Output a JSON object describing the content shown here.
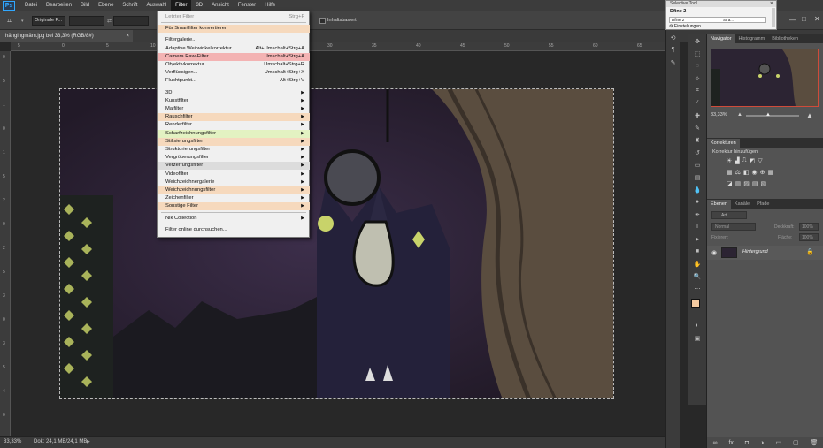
{
  "menubar": {
    "items": [
      "Datei",
      "Bearbeiten",
      "Bild",
      "Ebene",
      "Schrift",
      "Auswahl",
      "Filter",
      "3D",
      "Ansicht",
      "Fenster",
      "Hilfe"
    ],
    "active": "Filter",
    "logo": "Ps"
  },
  "options": {
    "preset": "Originale P...",
    "checkbox_label": "Inhaltsbasiert"
  },
  "document": {
    "tab_title": "hängingmäm.jpg bei 33,3% (RGB/8#)",
    "zoom": "33,33%",
    "doc_info": "Dok: 24,1 MB/24,1 MB"
  },
  "filter_menu": {
    "rows": [
      {
        "label": "Letzter Filter",
        "shortcut": "Strg+F",
        "highlight": "none",
        "disabled": true,
        "arrow": false
      },
      {
        "label": "Für Smartfilter konvertieren",
        "shortcut": "",
        "highlight": "orange",
        "disabled": false,
        "arrow": false
      },
      {
        "label": "Filtergalerie...",
        "shortcut": "",
        "highlight": "none",
        "disabled": false,
        "arrow": false
      },
      {
        "label": "Adaptive Weitwinkelkorrektur...",
        "shortcut": "Alt+Umschalt+Strg+A",
        "highlight": "none",
        "disabled": false,
        "arrow": false
      },
      {
        "label": "Camera Raw-Filter...",
        "shortcut": "Umschalt+Strg+A",
        "highlight": "red",
        "disabled": false,
        "arrow": false
      },
      {
        "label": "Objektivkorrektur...",
        "shortcut": "Umschalt+Strg+R",
        "highlight": "none",
        "disabled": false,
        "arrow": false
      },
      {
        "label": "Verflüssigen...",
        "shortcut": "Umschalt+Strg+X",
        "highlight": "none",
        "disabled": false,
        "arrow": false
      },
      {
        "label": "Fluchtpunkt...",
        "shortcut": "Alt+Strg+V",
        "highlight": "none",
        "disabled": false,
        "arrow": false
      },
      {
        "label": "3D",
        "shortcut": "",
        "highlight": "none",
        "disabled": false,
        "arrow": true
      },
      {
        "label": "Kunstfilter",
        "shortcut": "",
        "highlight": "none",
        "disabled": false,
        "arrow": true
      },
      {
        "label": "Malfilter",
        "shortcut": "",
        "highlight": "none",
        "disabled": false,
        "arrow": true
      },
      {
        "label": "Rauschfilter",
        "shortcut": "",
        "highlight": "orange",
        "disabled": false,
        "arrow": true
      },
      {
        "label": "Renderfilter",
        "shortcut": "",
        "highlight": "none",
        "disabled": false,
        "arrow": true
      },
      {
        "label": "Scharfzeichnungsfilter",
        "shortcut": "",
        "highlight": "green",
        "disabled": false,
        "arrow": true
      },
      {
        "label": "Stilisierungsfilter",
        "shortcut": "",
        "highlight": "orange",
        "disabled": false,
        "arrow": true
      },
      {
        "label": "Strukturierungsfilter",
        "shortcut": "",
        "highlight": "none",
        "disabled": false,
        "arrow": true
      },
      {
        "label": "Vergröberungsfilter",
        "shortcut": "",
        "highlight": "none",
        "disabled": false,
        "arrow": true
      },
      {
        "label": "Verzerrungsfilter",
        "shortcut": "",
        "highlight": "gray",
        "disabled": false,
        "arrow": true
      },
      {
        "label": "Videofilter",
        "shortcut": "",
        "highlight": "none",
        "disabled": false,
        "arrow": true
      },
      {
        "label": "Weichzeichnergalerie",
        "shortcut": "",
        "highlight": "none",
        "disabled": false,
        "arrow": true
      },
      {
        "label": "Weichzeichnungsfilter",
        "shortcut": "",
        "highlight": "orange",
        "disabled": false,
        "arrow": true
      },
      {
        "label": "Zeichenfilter",
        "shortcut": "",
        "highlight": "none",
        "disabled": false,
        "arrow": true
      },
      {
        "label": "Sonstige Filter",
        "shortcut": "",
        "highlight": "orange",
        "disabled": false,
        "arrow": true
      },
      {
        "label": "Nik Collection",
        "shortcut": "",
        "highlight": "none",
        "disabled": false,
        "arrow": true
      },
      {
        "label": "Filter online durchsuchen...",
        "shortcut": "",
        "highlight": "none",
        "disabled": false,
        "arrow": false
      }
    ]
  },
  "selective_tool": {
    "title": "Selective Tool",
    "row1": "Dfine 2",
    "row2a": "Dfine 2",
    "row2b": "Stra...",
    "settings": "Einstellungen"
  },
  "panels": {
    "navigator_tabs": [
      "Navigator",
      "Histogramm",
      "Bibliotheken"
    ],
    "nav_zoom": "33,33%",
    "korrekturen_title": "Korrekturen",
    "korrekturen_hint": "Korrektur hinzufügen",
    "layers_tabs": [
      "Ebenen",
      "Kanäle",
      "Pfade"
    ],
    "layer_kind": "Art",
    "blend_mode": "Normal",
    "opacity_label": "Deckkraft:",
    "opacity_value": "100%",
    "lock_label": "Fixieren:",
    "fill_label": "Fläche:",
    "fill_value": "100%",
    "layer_name": "Hintergrund"
  },
  "colors": {
    "highlight_orange": "#f6d9bd",
    "highlight_red": "#f3b3b3",
    "highlight_green": "#e3f2c2",
    "highlight_gray": "#dcdcdc",
    "fg_swatch": "#f3c9a0",
    "bg_swatch": "#ffffff"
  },
  "ruler": {
    "top_ticks": [
      "5",
      "0",
      "5",
      "10",
      "15",
      "20",
      "25",
      "30",
      "35",
      "40",
      "45",
      "50",
      "55",
      "60",
      "65"
    ],
    "left_ticks": [
      "0",
      "5",
      "1",
      "0",
      "1",
      "5",
      "2",
      "0",
      "2",
      "5",
      "3",
      "0",
      "3",
      "5",
      "4",
      "0"
    ]
  }
}
